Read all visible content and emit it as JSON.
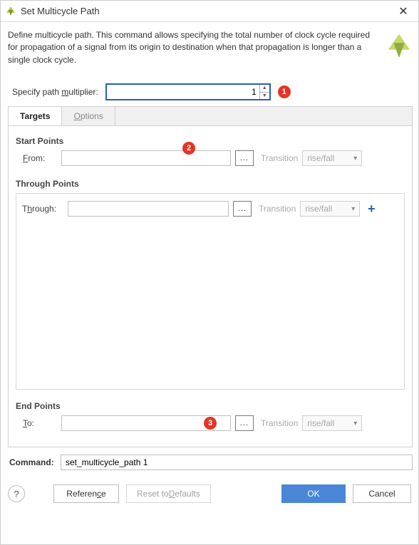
{
  "window": {
    "title": "Set Multicycle Path",
    "description": "Define multicycle path. This command allows specifying the total number of clock cycle required for propagation of a signal from its origin to destination when that propagation is longer than a single clock cycle."
  },
  "multiplier": {
    "label_pre": "Specify path ",
    "label_u": "m",
    "label_post": "ultiplier:",
    "value": "1",
    "callout": "1"
  },
  "tabs": {
    "targets": "Targets",
    "options_u": "O",
    "options_post": "ptions"
  },
  "sections": {
    "start": "Start Points",
    "through": "Through Points",
    "end": "End Points"
  },
  "from": {
    "label_u": "F",
    "label_post": "rom:",
    "value": "",
    "ellipsis": "...",
    "transition": "Transition",
    "select": "rise/fall",
    "callout": "2"
  },
  "through": {
    "label_pre": "T",
    "label_u": "h",
    "label_post": "rough:",
    "value": "",
    "ellipsis": "...",
    "transition": "Transition",
    "select": "rise/fall"
  },
  "to": {
    "label_u": "T",
    "label_post": "o:",
    "value": "",
    "ellipsis": "...",
    "transition": "Transition",
    "select": "rise/fall",
    "callout": "3"
  },
  "command": {
    "label": "Command:",
    "value": "set_multicycle_path 1"
  },
  "footer": {
    "help": "?",
    "reference_pre": "Referen",
    "reference_u": "c",
    "reference_post": "e",
    "reset_pre": "Reset to ",
    "reset_u": "D",
    "reset_post": "efaults",
    "ok": "OK",
    "cancel": "Cancel"
  }
}
